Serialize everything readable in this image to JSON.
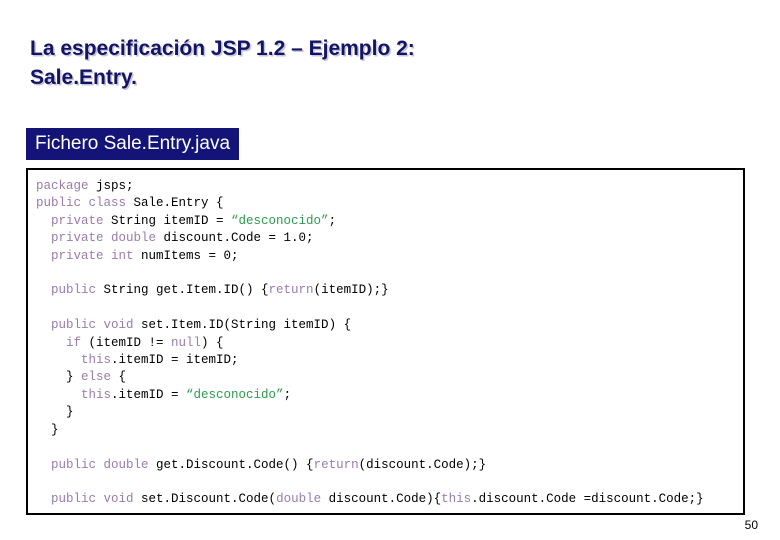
{
  "slide": {
    "title": "La especificación JSP 1.2 – Ejemplo 2:\nSale.Entry.",
    "page_number": "50",
    "colors": {
      "title": "#141464",
      "header_bar_bg": "#141478",
      "header_bar_text": "#ffffff",
      "code_keyword": "#9b7bab",
      "code_string": "#2e9b4f",
      "code_plain": "#000000",
      "code_border": "#000000",
      "background": "#ffffff"
    }
  },
  "file_header": {
    "label": "Fichero Sale.Entry.java"
  },
  "code": {
    "language": "java",
    "lines": [
      [
        {
          "t": "package",
          "c": "kw"
        },
        {
          "t": " jsps;",
          "c": "plain"
        }
      ],
      [
        {
          "t": "public class",
          "c": "kw"
        },
        {
          "t": " Sale.Entry {",
          "c": "plain"
        }
      ],
      [
        {
          "t": "  private",
          "c": "kw"
        },
        {
          "t": " String itemID = ",
          "c": "plain"
        },
        {
          "t": "“desconocido”",
          "c": "str"
        },
        {
          "t": ";",
          "c": "plain"
        }
      ],
      [
        {
          "t": "  private double",
          "c": "kw"
        },
        {
          "t": " discount.Code = 1.0;",
          "c": "plain"
        }
      ],
      [
        {
          "t": "  private int",
          "c": "kw"
        },
        {
          "t": " numItems = 0;",
          "c": "plain"
        }
      ],
      [
        {
          "t": "",
          "c": "plain"
        }
      ],
      [
        {
          "t": "  public",
          "c": "kw"
        },
        {
          "t": " String get.Item.ID() {",
          "c": "plain"
        },
        {
          "t": "return",
          "c": "kw"
        },
        {
          "t": "(itemID);}",
          "c": "plain"
        }
      ],
      [
        {
          "t": "",
          "c": "plain"
        }
      ],
      [
        {
          "t": "  public void",
          "c": "kw"
        },
        {
          "t": " set.Item.ID(String itemID) {",
          "c": "plain"
        }
      ],
      [
        {
          "t": "    if",
          "c": "kw"
        },
        {
          "t": " (itemID != ",
          "c": "plain"
        },
        {
          "t": "null",
          "c": "kw"
        },
        {
          "t": ") {",
          "c": "plain"
        }
      ],
      [
        {
          "t": "      this",
          "c": "kw"
        },
        {
          "t": ".itemID = itemID;",
          "c": "plain"
        }
      ],
      [
        {
          "t": "    } ",
          "c": "plain"
        },
        {
          "t": "else",
          "c": "kw"
        },
        {
          "t": " {",
          "c": "plain"
        }
      ],
      [
        {
          "t": "      this",
          "c": "kw"
        },
        {
          "t": ".itemID = ",
          "c": "plain"
        },
        {
          "t": "“desconocido”",
          "c": "str"
        },
        {
          "t": ";",
          "c": "plain"
        }
      ],
      [
        {
          "t": "    }",
          "c": "plain"
        }
      ],
      [
        {
          "t": "  }",
          "c": "plain"
        }
      ],
      [
        {
          "t": "",
          "c": "plain"
        }
      ],
      [
        {
          "t": "  public double",
          "c": "kw"
        },
        {
          "t": " get.Discount.Code() {",
          "c": "plain"
        },
        {
          "t": "return",
          "c": "kw"
        },
        {
          "t": "(discount.Code);}",
          "c": "plain"
        }
      ],
      [
        {
          "t": "",
          "c": "plain"
        }
      ],
      [
        {
          "t": "  public void",
          "c": "kw"
        },
        {
          "t": " set.Discount.Code(",
          "c": "plain"
        },
        {
          "t": "double",
          "c": "kw"
        },
        {
          "t": " discount.Code){",
          "c": "plain"
        },
        {
          "t": "this",
          "c": "kw"
        },
        {
          "t": ".discount.Code =discount.Code;}",
          "c": "plain"
        }
      ]
    ]
  }
}
